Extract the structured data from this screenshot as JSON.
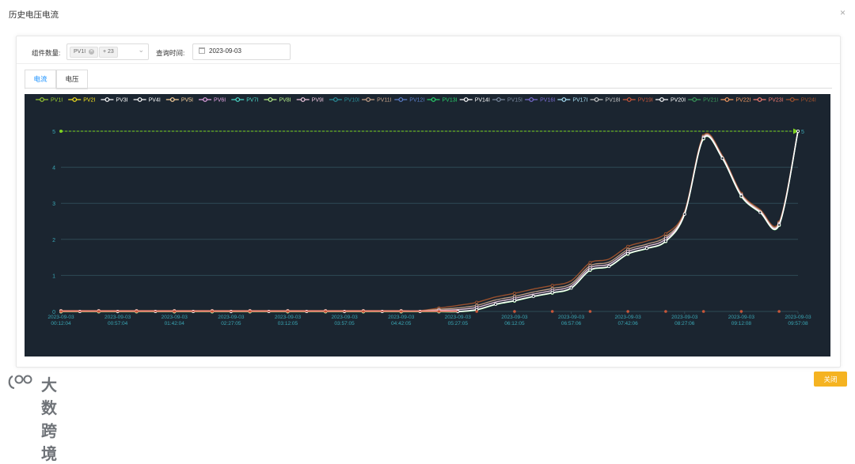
{
  "dialog": {
    "title": "历史电压电流",
    "close_glyph": "×"
  },
  "filters": {
    "component_label": "组件数量:",
    "selected_tag": "PV1I",
    "extra_count": "+ 23",
    "query_time_label": "查询时间:",
    "date_value": "2023-09-03"
  },
  "tabs": [
    {
      "label": "电流",
      "active": true
    },
    {
      "label": "电压",
      "active": false
    }
  ],
  "footer": {
    "close_button": "关闭",
    "watermark": "大数跨境"
  },
  "colors": {
    "chart_bg": "#1b2530",
    "accent": "#1890ff",
    "button": "#f5b321",
    "axis_label": "#3aa7b5",
    "markline": "#7ed321"
  },
  "chart_data": {
    "type": "line",
    "legend_position": "top",
    "series": [
      {
        "name": "PV1I",
        "color": "#9acd32"
      },
      {
        "name": "PV2I",
        "color": "#f5e21d"
      },
      {
        "name": "PV3I",
        "color": "#ffffff"
      },
      {
        "name": "PV4I",
        "color": "#ffffff"
      },
      {
        "name": "PV5I",
        "color": "#ffd59e"
      },
      {
        "name": "PV6I",
        "color": "#e6a5e6"
      },
      {
        "name": "PV7I",
        "color": "#4ad9c9"
      },
      {
        "name": "PV8I",
        "color": "#b6ef8a"
      },
      {
        "name": "PV9I",
        "color": "#f0c8e0"
      },
      {
        "name": "PV10I",
        "color": "#2a8f9a"
      },
      {
        "name": "PV11I",
        "color": "#c8a48a"
      },
      {
        "name": "PV12I",
        "color": "#5b7ec9"
      },
      {
        "name": "PV13I",
        "color": "#28d06a"
      },
      {
        "name": "PV14I",
        "color": "#ffffff"
      },
      {
        "name": "PV15I",
        "color": "#7b8aa0"
      },
      {
        "name": "PV16I",
        "color": "#7a6cd4"
      },
      {
        "name": "PV17I",
        "color": "#a7dff5"
      },
      {
        "name": "PV18I",
        "color": "#c7c7c7"
      },
      {
        "name": "PV19I",
        "color": "#c9573a"
      },
      {
        "name": "PV20I",
        "color": "#ffffff"
      },
      {
        "name": "PV21I",
        "color": "#3a9a5a"
      },
      {
        "name": "PV22I",
        "color": "#f29a61"
      },
      {
        "name": "PV23I",
        "color": "#f07a70"
      },
      {
        "name": "PV24I",
        "color": "#a0522d"
      }
    ],
    "x_tick_labels": [
      [
        "2023-09-03",
        "00:12:04"
      ],
      [
        "2023-09-03",
        "00:57:04"
      ],
      [
        "2023-09-03",
        "01:42:04"
      ],
      [
        "2023-09-03",
        "02:27:05"
      ],
      [
        "2023-09-03",
        "03:12:05"
      ],
      [
        "2023-09-03",
        "03:57:05"
      ],
      [
        "2023-09-03",
        "04:42:05"
      ],
      [
        "2023-09-03",
        "05:27:05"
      ],
      [
        "2023-09-03",
        "06:12:05"
      ],
      [
        "2023-09-03",
        "06:57:06"
      ],
      [
        "2023-09-03",
        "07:42:06"
      ],
      [
        "2023-09-03",
        "08:27:06"
      ],
      [
        "2023-09-03",
        "09:12:08"
      ],
      [
        "2023-09-03",
        "09:57:08"
      ]
    ],
    "ylim": [
      0,
      5
    ],
    "y_ticks": [
      0,
      1,
      2,
      3,
      4,
      5
    ],
    "grid": true,
    "mark_line": {
      "value": 5,
      "label": "5"
    },
    "point_count": 40,
    "curve": [
      0,
      0,
      0,
      0,
      0,
      0,
      0,
      0,
      0,
      0,
      0,
      0,
      0,
      0,
      0,
      0,
      0,
      0,
      0,
      0,
      0,
      0,
      0.05,
      0.2,
      0.3,
      0.42,
      0.52,
      0.65,
      1.15,
      1.25,
      1.6,
      1.75,
      1.95,
      2.7,
      4.8,
      4.25,
      3.2,
      2.75,
      2.4,
      5.0
    ]
  }
}
